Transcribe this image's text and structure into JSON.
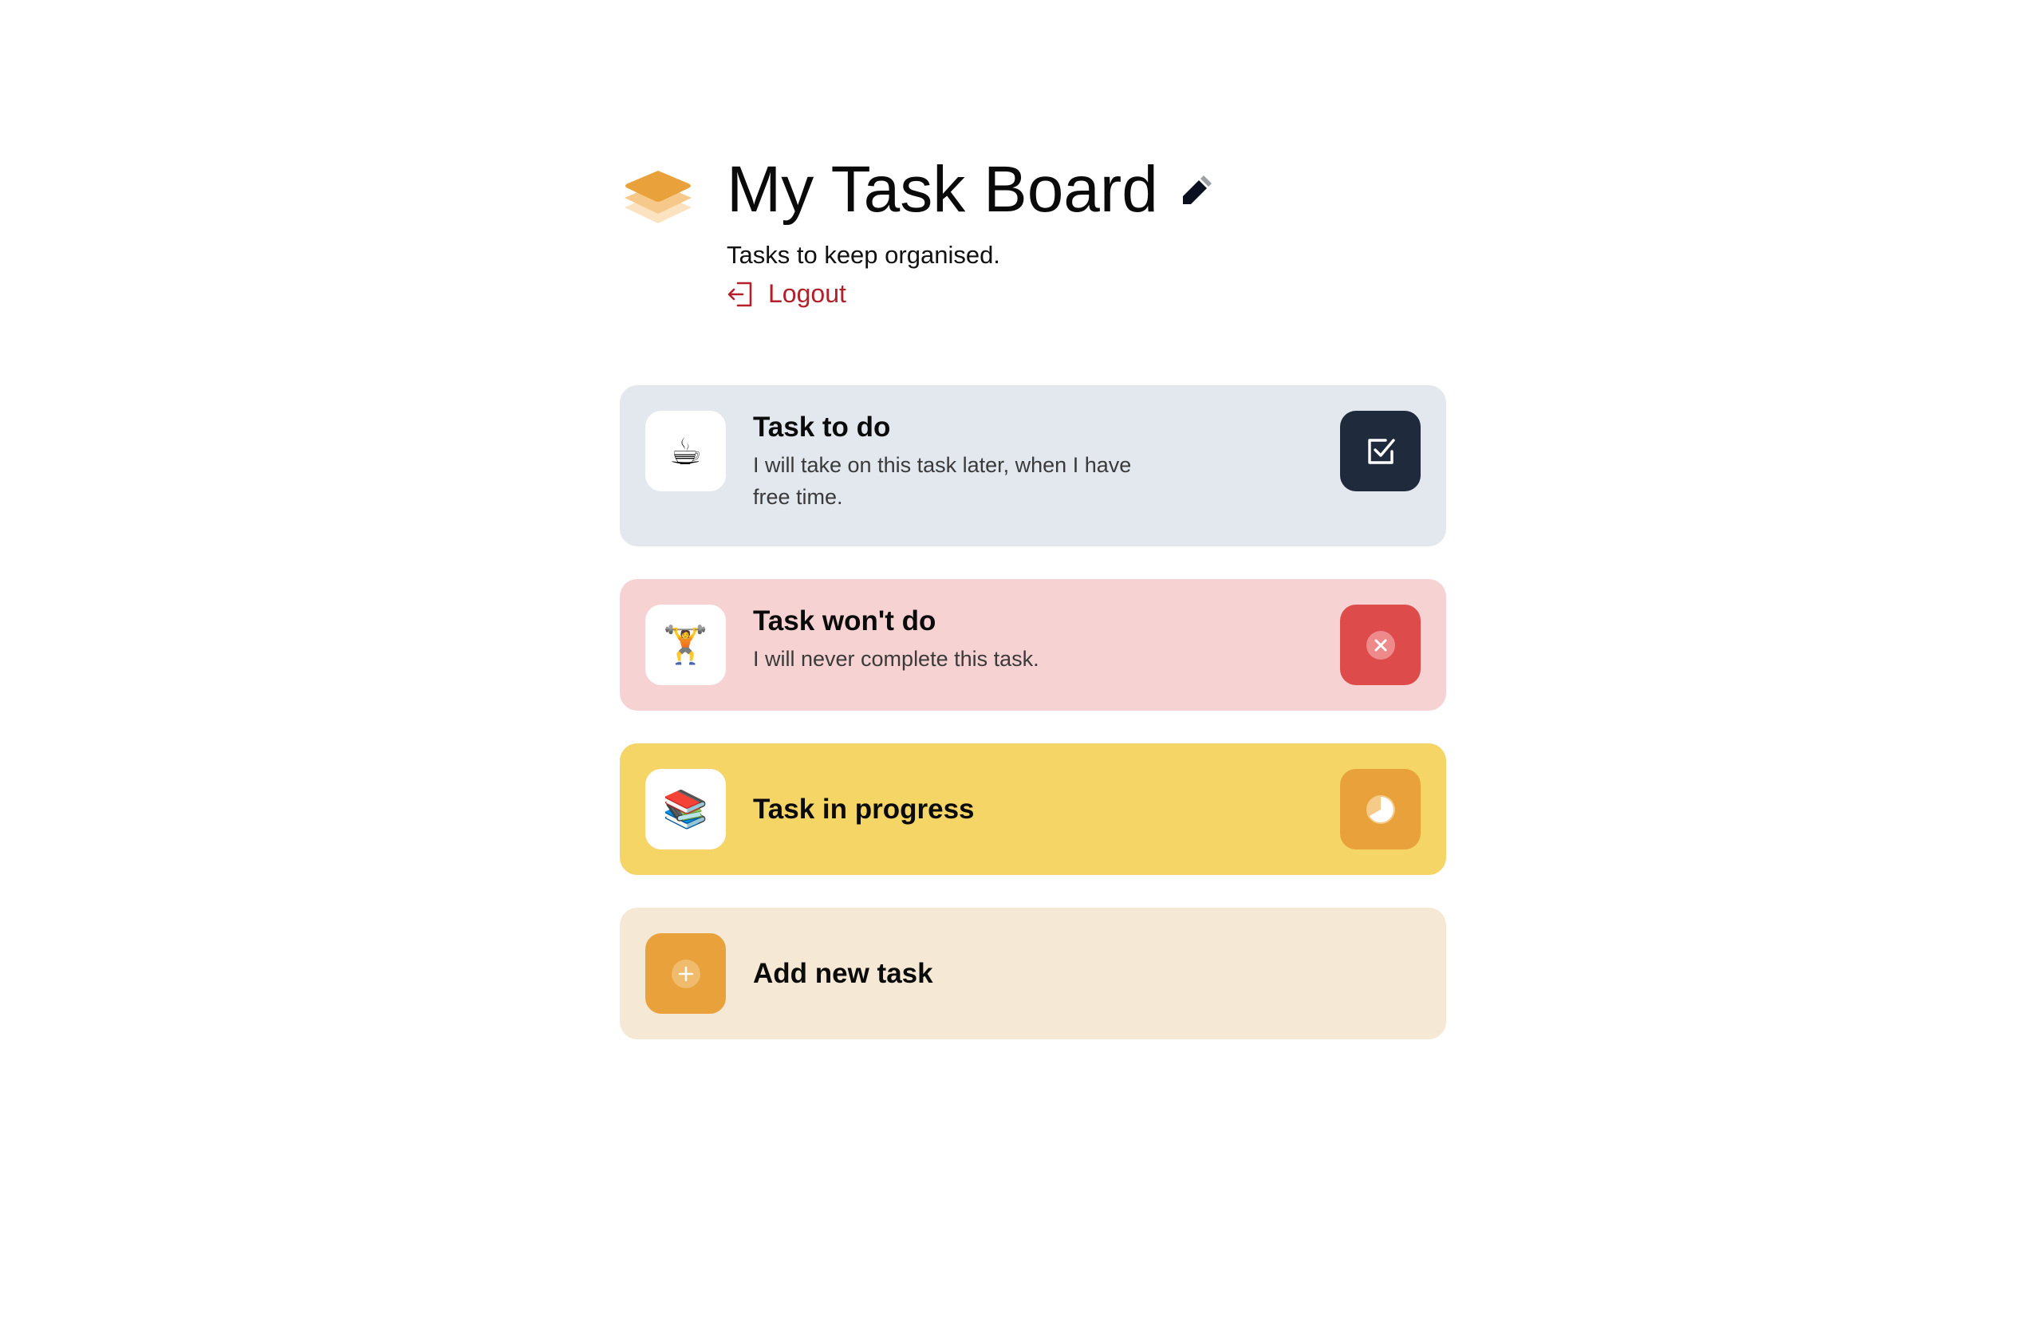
{
  "header": {
    "title": "My Task Board",
    "subtitle": "Tasks to keep organised.",
    "logout_label": "Logout",
    "logo_icon": "layers-icon",
    "edit_icon": "pencil-icon",
    "logout_icon": "logout-icon"
  },
  "tasks": [
    {
      "title": "Task to do",
      "description": "I will take on this task later, when I have free time.",
      "emoji": "☕",
      "status_icon": "check-square-icon",
      "status_color": "#1f2a3d",
      "background": "#e3e7ee"
    },
    {
      "title": "Task won't do",
      "description": "I will never complete this task.",
      "emoji": "🏋️",
      "status_icon": "close-icon",
      "status_color": "#dd4b4b",
      "background": "#f7d2d3"
    },
    {
      "title": "Task in progress",
      "description": "",
      "emoji": "📚",
      "status_icon": "progress-icon",
      "status_color": "#e9a13b",
      "background": "#f4d565"
    }
  ],
  "add_task": {
    "label": "Add new task",
    "icon": "plus-icon",
    "background": "#f5e8d4"
  },
  "colors": {
    "accent": "#e9a13b",
    "logout": "#b3202a"
  }
}
